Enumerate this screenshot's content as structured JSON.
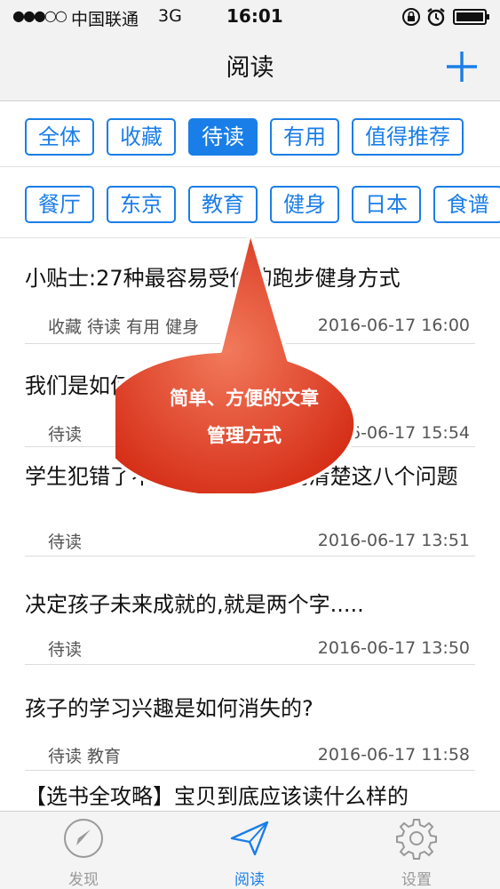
{
  "status_bar": {
    "signal": "●●●○○",
    "carrier": "中国联通",
    "network": "3G",
    "time": "16:01"
  },
  "nav": {
    "title": "阅读",
    "add_icon": "plus-icon"
  },
  "filters_row1": [
    "全体",
    "收藏",
    "待读",
    "有用",
    "值得推荐"
  ],
  "filters_row1_active": "待读",
  "filters_row2": [
    "餐厅",
    "东京",
    "教育",
    "健身",
    "日本",
    "食谱"
  ],
  "articles": [
    {
      "title": "小贴士:27种最容易受伤的跑步健身方式",
      "tags": "收藏 待读 有用 健身",
      "date": "2016-06-17 16:00"
    },
    {
      "title": "我们是如何毁掉孩子的?",
      "tags": "待读",
      "date": "2016-06-17 15:54"
    },
    {
      "title": "学生犯错了不要急着批评,先问清楚这八个问题",
      "tags": "待读",
      "date": "2016-06-17 13:51"
    },
    {
      "title": "决定孩子未来成就的,就是两个字.....",
      "tags": "待读",
      "date": "2016-06-17 13:50"
    },
    {
      "title": "孩子的学习兴趣是如何消失的?",
      "tags": "待读 教育",
      "date": "2016-06-17 11:58"
    },
    {
      "title": "【选书全攻略】宝贝到底应该读什么样的",
      "tags": "",
      "date": ""
    }
  ],
  "callout": {
    "line1": "简单、方便的文章",
    "line2": "管理方式"
  },
  "tabs": [
    {
      "label": "发现",
      "icon": "compass-icon"
    },
    {
      "label": "阅读",
      "icon": "paper-plane-icon"
    },
    {
      "label": "设置",
      "icon": "gear-icon"
    }
  ],
  "colors": {
    "accent": "#1a7ee8",
    "callout": "#e23b22"
  }
}
